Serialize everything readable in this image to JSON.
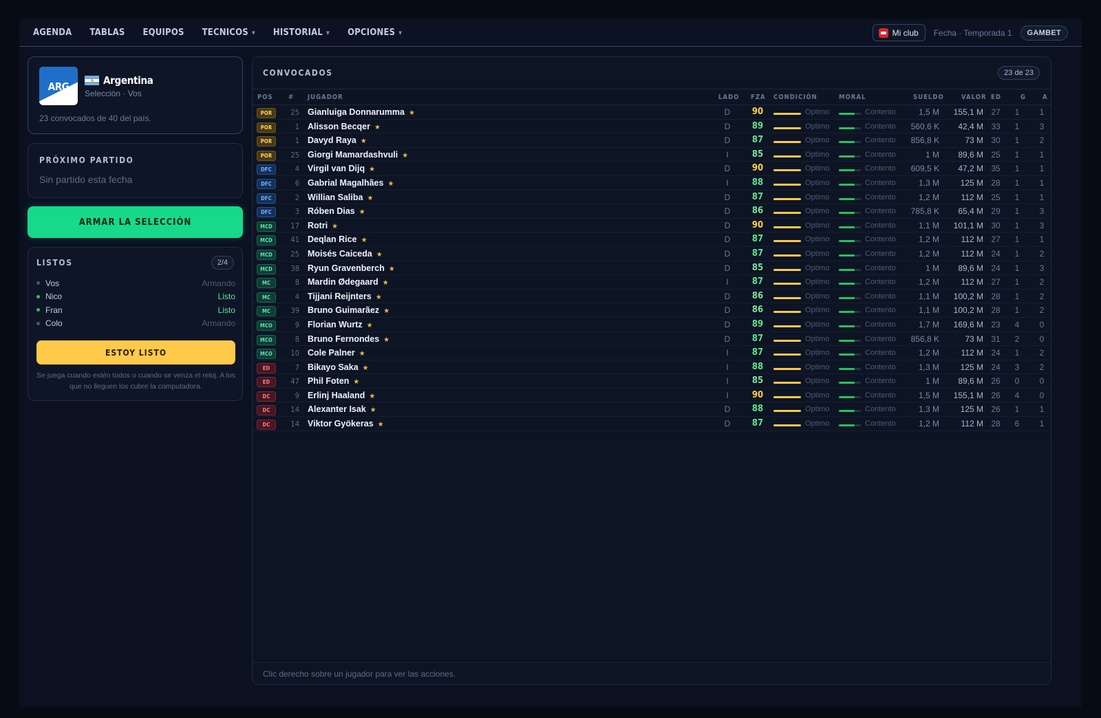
{
  "nav": {
    "items": [
      {
        "label": "AGENDA",
        "dropdown": false
      },
      {
        "label": "TABLAS",
        "dropdown": false
      },
      {
        "label": "EQUIPOS",
        "dropdown": false
      },
      {
        "label": "TECNICOS",
        "dropdown": true
      },
      {
        "label": "HISTORIAL",
        "dropdown": true
      },
      {
        "label": "OPCIONES",
        "dropdown": true
      }
    ],
    "club_button": "Mi club",
    "fecha": "Fecha · Temporada 1",
    "user": "GAMBET"
  },
  "team": {
    "code": "ARG",
    "name": "Argentina",
    "subtitle": "Selección · Vos",
    "note": "23 convocados de 40 del país."
  },
  "next_match": {
    "title": "PRÓXIMO PARTIDO",
    "empty": "Sin partido esta fecha"
  },
  "armar_button": "ARMAR LA SELECCIÓN",
  "listos": {
    "title": "LISTOS",
    "count": "2/4",
    "players": [
      {
        "name": "Vos",
        "status": "Armando",
        "ready": false
      },
      {
        "name": "Nico",
        "status": "Listo",
        "ready": true
      },
      {
        "name": "Fran",
        "status": "Listo",
        "ready": true
      },
      {
        "name": "Colo",
        "status": "Armando",
        "ready": false
      }
    ],
    "button": "ESTOY LISTO",
    "help": "Se juega cuando estén todos o cuando se venza el reloj. A los que no lleguen los cubre la computadora."
  },
  "squad": {
    "title": "CONVOCADOS",
    "count": "23 de 23",
    "headers": {
      "pos": "POS",
      "num": "#",
      "name": "JUGADOR",
      "lado": "LADO",
      "fza": "FZA",
      "cond": "CONDICIÓN",
      "moral": "MORAL",
      "sueldo": "SUELDO",
      "valor": "VALOR",
      "ed": "ED",
      "g": "G",
      "a": "A"
    },
    "rows": [
      {
        "pos": "POR",
        "num": "25",
        "name": "Gianluiga Donnarumma",
        "lado": "D",
        "fza": "90",
        "cond": "Optimo",
        "moral": "Contento",
        "sueldo": "1,5 M",
        "valor": "155,1 M",
        "ed": "27",
        "g": "1",
        "a": "1"
      },
      {
        "pos": "POR",
        "num": "1",
        "name": "Alisson Becqer",
        "lado": "D",
        "fza": "89",
        "cond": "Optimo",
        "moral": "Contento",
        "sueldo": "560,6 K",
        "valor": "42,4 M",
        "ed": "33",
        "g": "1",
        "a": "3"
      },
      {
        "pos": "POR",
        "num": "1",
        "name": "Davyd Raya",
        "lado": "D",
        "fza": "87",
        "cond": "Optimo",
        "moral": "Contento",
        "sueldo": "856,8 K",
        "valor": "73 M",
        "ed": "30",
        "g": "1",
        "a": "2"
      },
      {
        "pos": "POR",
        "num": "25",
        "name": "Giorgi Mamardashvuli",
        "lado": "I",
        "fza": "85",
        "cond": "Optimo",
        "moral": "Contento",
        "sueldo": "1 M",
        "valor": "89,6 M",
        "ed": "25",
        "g": "1",
        "a": "1"
      },
      {
        "pos": "DFC",
        "num": "4",
        "name": "Virgil van Dijq",
        "lado": "D",
        "fza": "90",
        "cond": "Optimo",
        "moral": "Contento",
        "sueldo": "609,5 K",
        "valor": "47,2 M",
        "ed": "35",
        "g": "1",
        "a": "1"
      },
      {
        "pos": "DFC",
        "num": "6",
        "name": "Gabrial Magalhães",
        "lado": "I",
        "fza": "88",
        "cond": "Optimo",
        "moral": "Contento",
        "sueldo": "1,3 M",
        "valor": "125 M",
        "ed": "28",
        "g": "1",
        "a": "1"
      },
      {
        "pos": "DFC",
        "num": "2",
        "name": "Willian Saliba",
        "lado": "D",
        "fza": "87",
        "cond": "Optimo",
        "moral": "Contento",
        "sueldo": "1,2 M",
        "valor": "112 M",
        "ed": "25",
        "g": "1",
        "a": "1"
      },
      {
        "pos": "DFC",
        "num": "3",
        "name": "Róben Dias",
        "lado": "D",
        "fza": "86",
        "cond": "Optimo",
        "moral": "Contento",
        "sueldo": "785,8 K",
        "valor": "65,4 M",
        "ed": "29",
        "g": "1",
        "a": "3"
      },
      {
        "pos": "MCD",
        "num": "17",
        "name": "Rotri",
        "lado": "D",
        "fza": "90",
        "cond": "Optimo",
        "moral": "Contento",
        "sueldo": "1,1 M",
        "valor": "101,1 M",
        "ed": "30",
        "g": "1",
        "a": "3"
      },
      {
        "pos": "MCD",
        "num": "41",
        "name": "Deqlan Rice",
        "lado": "D",
        "fza": "87",
        "cond": "Optimo",
        "moral": "Contento",
        "sueldo": "1,2 M",
        "valor": "112 M",
        "ed": "27",
        "g": "1",
        "a": "1"
      },
      {
        "pos": "MCD",
        "num": "25",
        "name": "Moisés Caiceda",
        "lado": "D",
        "fza": "87",
        "cond": "Optimo",
        "moral": "Contento",
        "sueldo": "1,2 M",
        "valor": "112 M",
        "ed": "24",
        "g": "1",
        "a": "2"
      },
      {
        "pos": "MCD",
        "num": "38",
        "name": "Ryun Gravenberch",
        "lado": "D",
        "fza": "85",
        "cond": "Optimo",
        "moral": "Contento",
        "sueldo": "1 M",
        "valor": "89,6 M",
        "ed": "24",
        "g": "1",
        "a": "3"
      },
      {
        "pos": "MC",
        "num": "8",
        "name": "Mardin Ødegaard",
        "lado": "I",
        "fza": "87",
        "cond": "Optimo",
        "moral": "Contento",
        "sueldo": "1,2 M",
        "valor": "112 M",
        "ed": "27",
        "g": "1",
        "a": "2"
      },
      {
        "pos": "MC",
        "num": "4",
        "name": "Tijjani Reijnters",
        "lado": "D",
        "fza": "86",
        "cond": "Optimo",
        "moral": "Contento",
        "sueldo": "1,1 M",
        "valor": "100,2 M",
        "ed": "28",
        "g": "1",
        "a": "2"
      },
      {
        "pos": "MC",
        "num": "39",
        "name": "Bruno Guimarãez",
        "lado": "D",
        "fza": "86",
        "cond": "Optimo",
        "moral": "Contento",
        "sueldo": "1,1 M",
        "valor": "100,2 M",
        "ed": "28",
        "g": "1",
        "a": "2"
      },
      {
        "pos": "MCO",
        "num": "9",
        "name": "Florian Wurtz",
        "lado": "D",
        "fza": "89",
        "cond": "Optimo",
        "moral": "Contento",
        "sueldo": "1,7 M",
        "valor": "169,6 M",
        "ed": "23",
        "g": "4",
        "a": "0"
      },
      {
        "pos": "MCO",
        "num": "8",
        "name": "Bruno Fernondes",
        "lado": "D",
        "fza": "87",
        "cond": "Optimo",
        "moral": "Contento",
        "sueldo": "856,8 K",
        "valor": "73 M",
        "ed": "31",
        "g": "2",
        "a": "0"
      },
      {
        "pos": "MCO",
        "num": "10",
        "name": "Cole Palner",
        "lado": "I",
        "fza": "87",
        "cond": "Optimo",
        "moral": "Contento",
        "sueldo": "1,2 M",
        "valor": "112 M",
        "ed": "24",
        "g": "1",
        "a": "2"
      },
      {
        "pos": "ED",
        "num": "7",
        "name": "Bikayo Saka",
        "lado": "I",
        "fza": "88",
        "cond": "Optimo",
        "moral": "Contento",
        "sueldo": "1,3 M",
        "valor": "125 M",
        "ed": "24",
        "g": "3",
        "a": "2"
      },
      {
        "pos": "ED",
        "num": "47",
        "name": "Phil Foten",
        "lado": "I",
        "fza": "85",
        "cond": "Optimo",
        "moral": "Contento",
        "sueldo": "1 M",
        "valor": "89,6 M",
        "ed": "26",
        "g": "0",
        "a": "0"
      },
      {
        "pos": "DC",
        "num": "9",
        "name": "Erlinj Haaland",
        "lado": "I",
        "fza": "90",
        "cond": "Optimo",
        "moral": "Contento",
        "sueldo": "1,5 M",
        "valor": "155,1 M",
        "ed": "26",
        "g": "4",
        "a": "0"
      },
      {
        "pos": "DC",
        "num": "14",
        "name": "Alexanter Isak",
        "lado": "D",
        "fza": "88",
        "cond": "Optimo",
        "moral": "Contento",
        "sueldo": "1,3 M",
        "valor": "125 M",
        "ed": "26",
        "g": "1",
        "a": "1"
      },
      {
        "pos": "DC",
        "num": "14",
        "name": "Viktor Gyökeras",
        "lado": "D",
        "fza": "87",
        "cond": "Optimo",
        "moral": "Contento",
        "sueldo": "1,2 M",
        "valor": "112 M",
        "ed": "28",
        "g": "6",
        "a": "1"
      }
    ],
    "footer_hint": "Clic derecho sobre un jugador para ver las acciones."
  }
}
